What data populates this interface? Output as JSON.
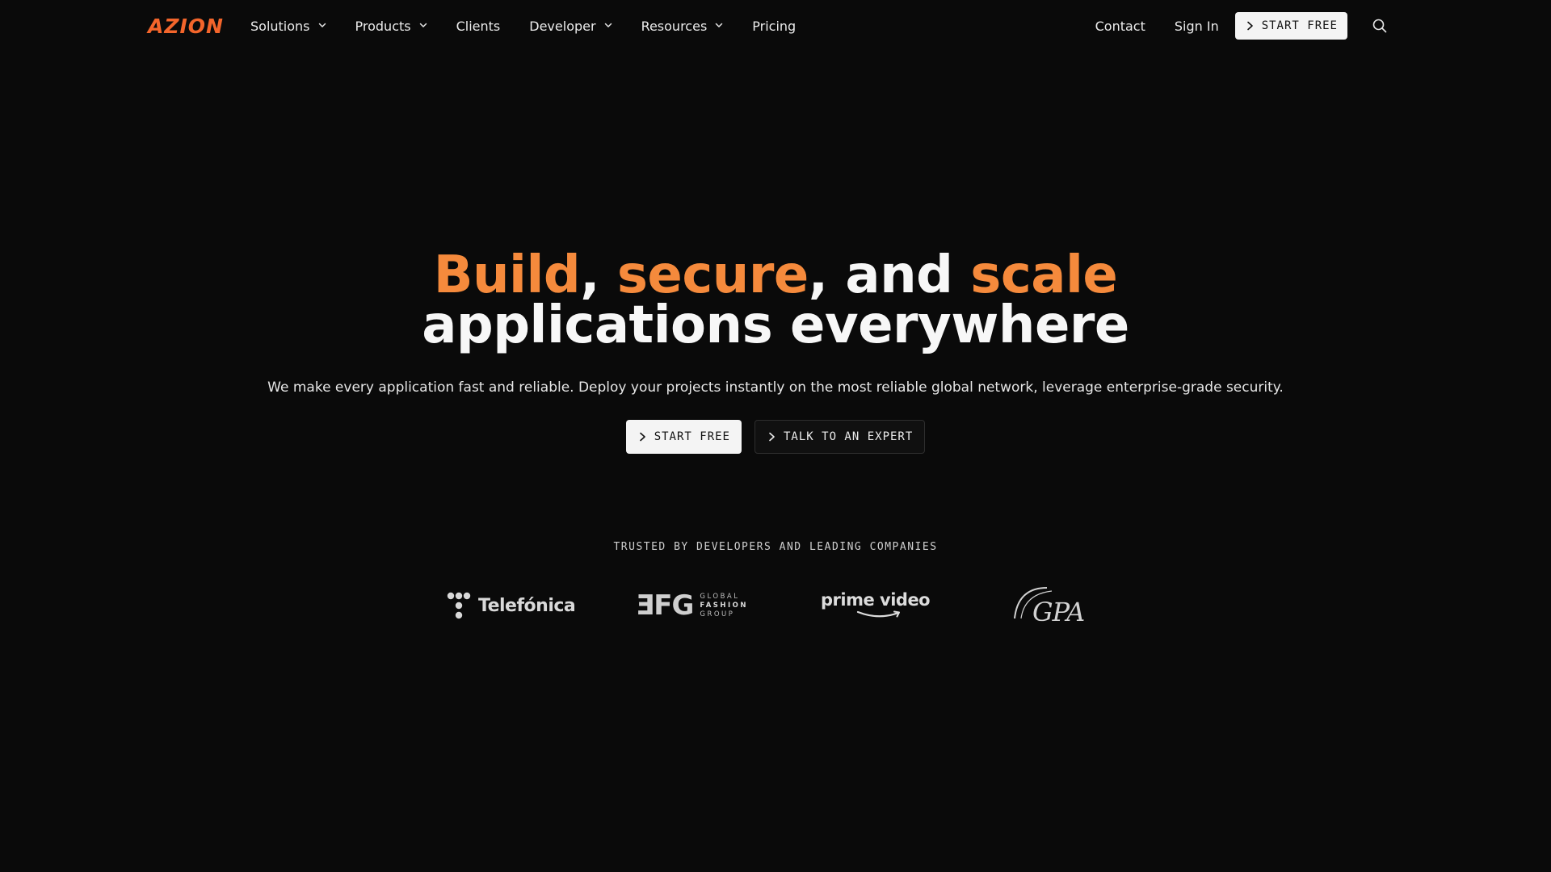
{
  "brand": {
    "logo_text": "AZION",
    "accent": "#f3652b"
  },
  "nav": {
    "left_items": [
      {
        "label": "Solutions",
        "has_dropdown": true
      },
      {
        "label": "Products",
        "has_dropdown": true
      },
      {
        "label": "Clients",
        "has_dropdown": false
      },
      {
        "label": "Developer",
        "has_dropdown": true
      },
      {
        "label": "Resources",
        "has_dropdown": true
      },
      {
        "label": "Pricing",
        "has_dropdown": false
      }
    ],
    "contact_label": "Contact",
    "signin_label": "Sign In",
    "cta_label": "START FREE",
    "search_icon": "search-icon"
  },
  "hero": {
    "headline_parts": {
      "build": "Build",
      "comma1": ",",
      "secure": "secure",
      "comma_and": ", and",
      "scale": "scale",
      "line2": "applications everywhere"
    },
    "subtitle": "We make every application fast and reliable. Deploy your projects instantly on the most reliable global network, leverage enterprise-grade security.",
    "primary_cta": "START FREE",
    "secondary_cta": "TALK TO AN EXPERT",
    "highlight_color": "#f58a3c"
  },
  "trusted": {
    "heading": "TRUSTED BY DEVELOPERS AND LEADING COMPANIES",
    "logos": {
      "telefonica": "Telefónica",
      "gfg_mark": "ƎFG",
      "gfg_line1": "GLOBAL",
      "gfg_line2": "FASHION",
      "gfg_line3": "GROUP",
      "prime": "prime video",
      "gpa": "GPA"
    }
  }
}
